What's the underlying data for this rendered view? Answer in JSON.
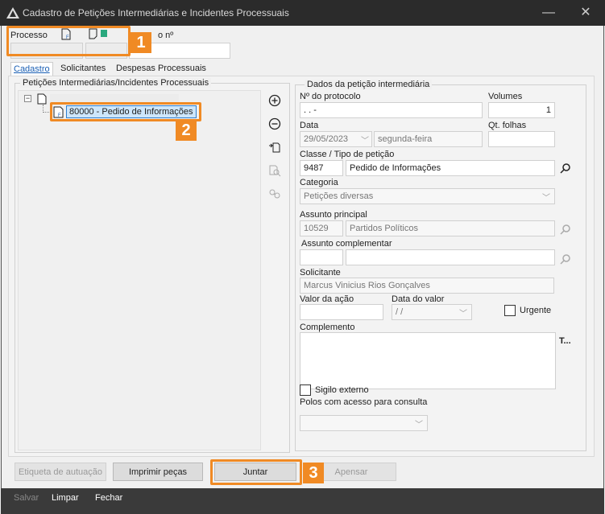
{
  "window": {
    "title": "Cadastro de Petições Intermediárias e Incidentes Processuais",
    "minimize": "—",
    "close": "✕"
  },
  "header": {
    "processo_label": "Processo",
    "numero_label": "o nº"
  },
  "tabs": [
    {
      "label": "Cadastro"
    },
    {
      "label": "Solicitantes"
    },
    {
      "label": "Despesas Processuais"
    }
  ],
  "left_panel": {
    "title": "Petições Intermediárias/Incidentes Processuais",
    "tree_selected": "80000 - Pedido de Informações"
  },
  "right_panel": {
    "title": "Dados da petição intermediária",
    "protocolo_label": "Nº do protocolo",
    "protocolo_value": ". . -",
    "volumes_label": "Volumes",
    "volumes_value": "1",
    "data_label": "Data",
    "data_value": "29/05/2023",
    "dia_semana": "segunda-feira",
    "qt_folhas_label": "Qt. folhas",
    "classe_label": "Classe / Tipo de petição",
    "classe_code": "9487",
    "classe_value": "Pedido de Informações",
    "categoria_label": "Categoria",
    "categoria_value": "Petições diversas",
    "assunto_principal_label": "Assunto principal",
    "assunto_principal_code": "10529",
    "assunto_principal_value": "Partidos Políticos",
    "assunto_compl_label": "Assunto complementar",
    "solicitante_label": "Solicitante",
    "solicitante_value": "Marcus Vinicius Rios Gonçalves",
    "valor_acao_label": "Valor da ação",
    "data_valor_label": "Data do valor",
    "data_valor_value": "/ /",
    "urgente_label": "Urgente",
    "complemento_label": "Complemento",
    "text_tool": "T...",
    "sigilo_label": "Sigilo externo",
    "polos_label": "Polos com acesso para consulta"
  },
  "buttons": {
    "etiqueta": "Etiqueta de autuação",
    "imprimir": "Imprimir peças",
    "juntar": "Juntar",
    "apensar": "Apensar"
  },
  "footer": {
    "salvar": "Salvar",
    "limpar": "Limpar",
    "fechar": "Fechar"
  },
  "callouts": [
    "1",
    "2",
    "3"
  ],
  "colors": {
    "accent": "#f08a24",
    "titlebar": "#2b2b2b",
    "selection": "#cde6fb"
  }
}
